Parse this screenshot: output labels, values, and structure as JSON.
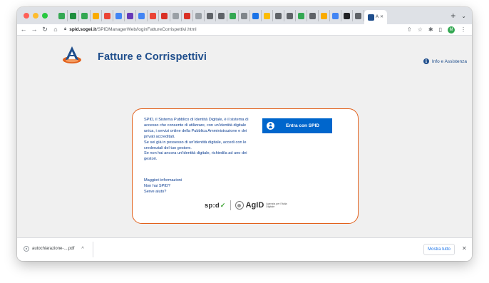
{
  "browser": {
    "tabs": [
      {
        "color": "#34a853"
      },
      {
        "color": "#1e8e3e"
      },
      {
        "color": "#34a853"
      },
      {
        "color": "#f9ab00"
      },
      {
        "color": "#ea4335"
      },
      {
        "color": "#4285f4"
      },
      {
        "color": "#673ab7"
      },
      {
        "color": "#4285f4"
      },
      {
        "color": "#ea4335"
      },
      {
        "color": "#d93025"
      },
      {
        "color": "#9aa0a6"
      },
      {
        "color": "#d93025"
      },
      {
        "color": "#9aa0a6"
      },
      {
        "color": "#5f6368"
      },
      {
        "color": "#5f6368"
      },
      {
        "color": "#34a853"
      },
      {
        "color": "#80868b"
      },
      {
        "color": "#1a73e8"
      },
      {
        "color": "#fbbc04"
      },
      {
        "color": "#5f6368"
      },
      {
        "color": "#5f6368"
      },
      {
        "color": "#34a853"
      },
      {
        "color": "#5f6368"
      },
      {
        "color": "#f9ab00"
      },
      {
        "color": "#4285f4"
      },
      {
        "color": "#202124"
      },
      {
        "color": "#5f6368"
      }
    ],
    "active_tab": {
      "title": "A",
      "color": "#1f4e8c"
    },
    "url_host": "spid.sogei.it",
    "url_path": "/SPIDManagerWeb/loginFattureCorrispettivi.html",
    "profile_initial": "M"
  },
  "header": {
    "title": "Fatture e Corrispettivi",
    "info_label": "Info e Assistenza",
    "info_icon": "i"
  },
  "login": {
    "paragraphs": [
      "SPID, il Sistema Pubblico di Identità Digitale, è il sistema di accesso che consente di utilizzare, con un'identità digitale unica, i servizi online della Pubblica Amministrazione e dei privati accreditati.",
      "Se sei già in possesso di un'identità digitale, accedi con le credenziali del tuo gestore.",
      "Se non hai ancora un'identità digitale, richiedila ad uno dei gestori."
    ],
    "links": [
      "Maggiori informazioni",
      "Non hai SPID?",
      "Serve aiuto?"
    ],
    "spid_button": "Entra con SPID",
    "spid_logo": "sp:d",
    "agid_logo": "AgID",
    "agid_caption": "Agenzia per l'Italia Digitale",
    "accent_color": "#e2611c",
    "button_color": "#0066cc"
  },
  "downloads": {
    "file": "autochiarazione-....pdf",
    "show_all": "Mostra tutto"
  }
}
